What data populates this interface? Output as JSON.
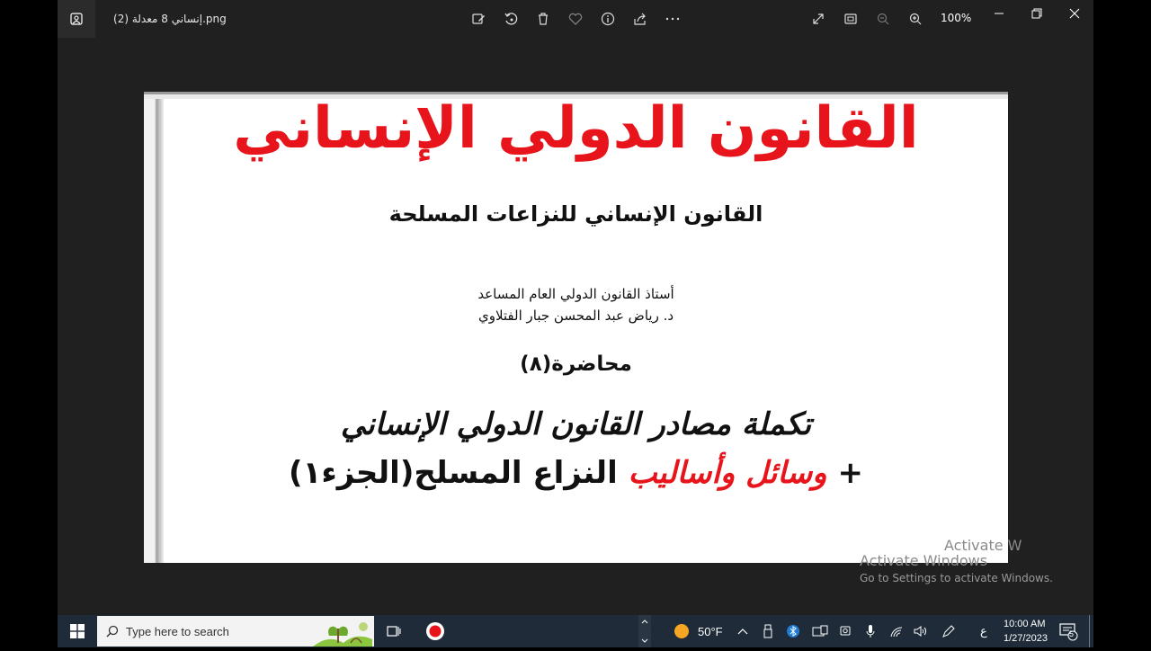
{
  "titlebar": {
    "filename": "إنساني 8 معدلة (2).png",
    "zoom": "100%"
  },
  "slide": {
    "title": "القانون الدولي الإنساني",
    "subtitle": "القانون الإنساني للنزاعات المسلحة",
    "professor_title": "أستاذ القانون الدولي العام المساعد",
    "professor_name": "د. رياض عبد المحسن جبار الفتلاوي",
    "lecture": "محاضرة(٨)",
    "line1": "تكملة مصادر القانون الدولي الإنساني",
    "line2_plus": "+",
    "line2_red": "وسائل وأساليب",
    "line2_black": "النزاع المسلح(الجزء١)"
  },
  "watermark": {
    "activate_partial": "Activate W",
    "activate": "Activate Windows",
    "goto": "Go to Settings to activate Windows."
  },
  "taskbar": {
    "search_placeholder": "Type here to search",
    "weather": "50°F",
    "lang": "ع",
    "time": "10:00 AM",
    "date": "1/27/2023",
    "notifications": "5"
  },
  "colors": {
    "accent_red": "#e8141b",
    "taskbar": "#1f2b39",
    "app_bg": "#202020"
  }
}
